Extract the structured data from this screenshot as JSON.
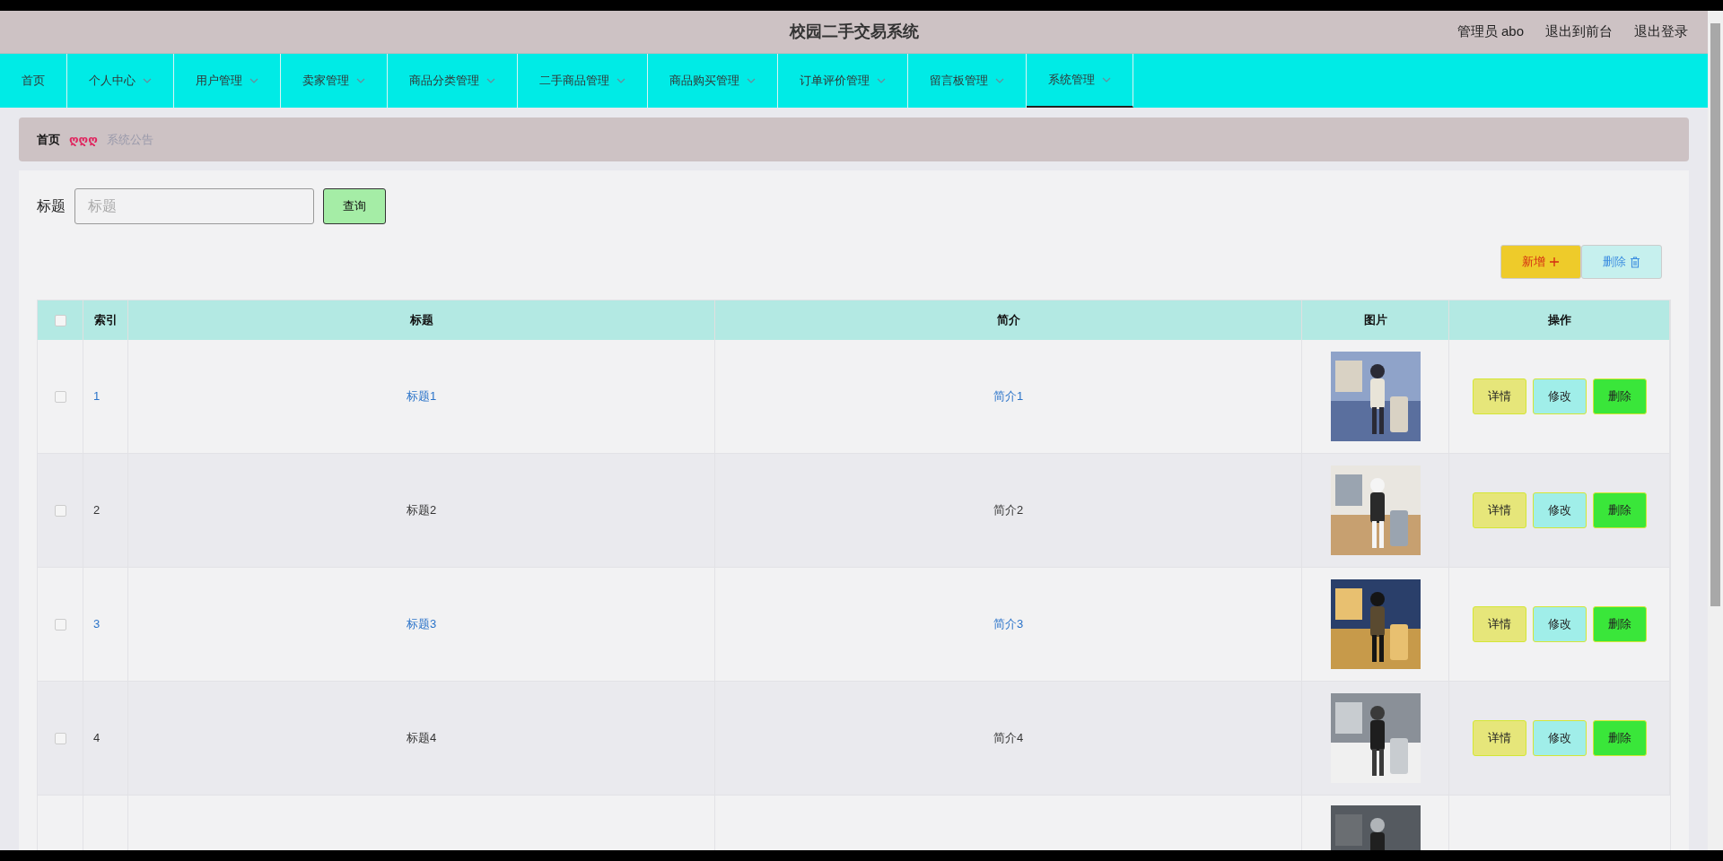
{
  "header": {
    "title": "校园二手交易系统",
    "user": "管理员 abo",
    "links": [
      "退出到前台",
      "退出登录"
    ]
  },
  "nav": [
    {
      "label": "首页",
      "has_menu": false,
      "selected": false
    },
    {
      "label": "个人中心",
      "has_menu": true,
      "selected": false
    },
    {
      "label": "用户管理",
      "has_menu": true,
      "selected": false
    },
    {
      "label": "卖家管理",
      "has_menu": true,
      "selected": false
    },
    {
      "label": "商品分类管理",
      "has_menu": true,
      "selected": false
    },
    {
      "label": "二手商品管理",
      "has_menu": true,
      "selected": false
    },
    {
      "label": "商品购买管理",
      "has_menu": true,
      "selected": false
    },
    {
      "label": "订单评价管理",
      "has_menu": true,
      "selected": false
    },
    {
      "label": "留言板管理",
      "has_menu": true,
      "selected": false
    },
    {
      "label": "系统管理",
      "has_menu": true,
      "selected": true
    }
  ],
  "breadcrumb": {
    "home": "首页",
    "separator": "ღღღ",
    "current": "系统公告"
  },
  "search": {
    "label": "标题",
    "placeholder": "标题",
    "button": "查询"
  },
  "toolbar": {
    "add": "新增",
    "delete": "删除"
  },
  "table": {
    "all_checked": false,
    "columns": [
      "索引",
      "标题",
      "简介",
      "图片",
      "操作"
    ],
    "rows": [
      {
        "index": "1",
        "title": "标题1",
        "intro": "简介1",
        "linked": true,
        "checked": false,
        "actions": [
          "详情",
          "修改",
          "删除"
        ]
      },
      {
        "index": "2",
        "title": "标题2",
        "intro": "简介2",
        "linked": false,
        "checked": false,
        "actions": [
          "详情",
          "修改",
          "删除"
        ]
      },
      {
        "index": "3",
        "title": "标题3",
        "intro": "简介3",
        "linked": true,
        "checked": false,
        "actions": [
          "详情",
          "修改",
          "删除"
        ]
      },
      {
        "index": "4",
        "title": "标题4",
        "intro": "简介4",
        "linked": false,
        "checked": false,
        "actions": [
          "详情",
          "修改",
          "删除"
        ]
      }
    ]
  }
}
